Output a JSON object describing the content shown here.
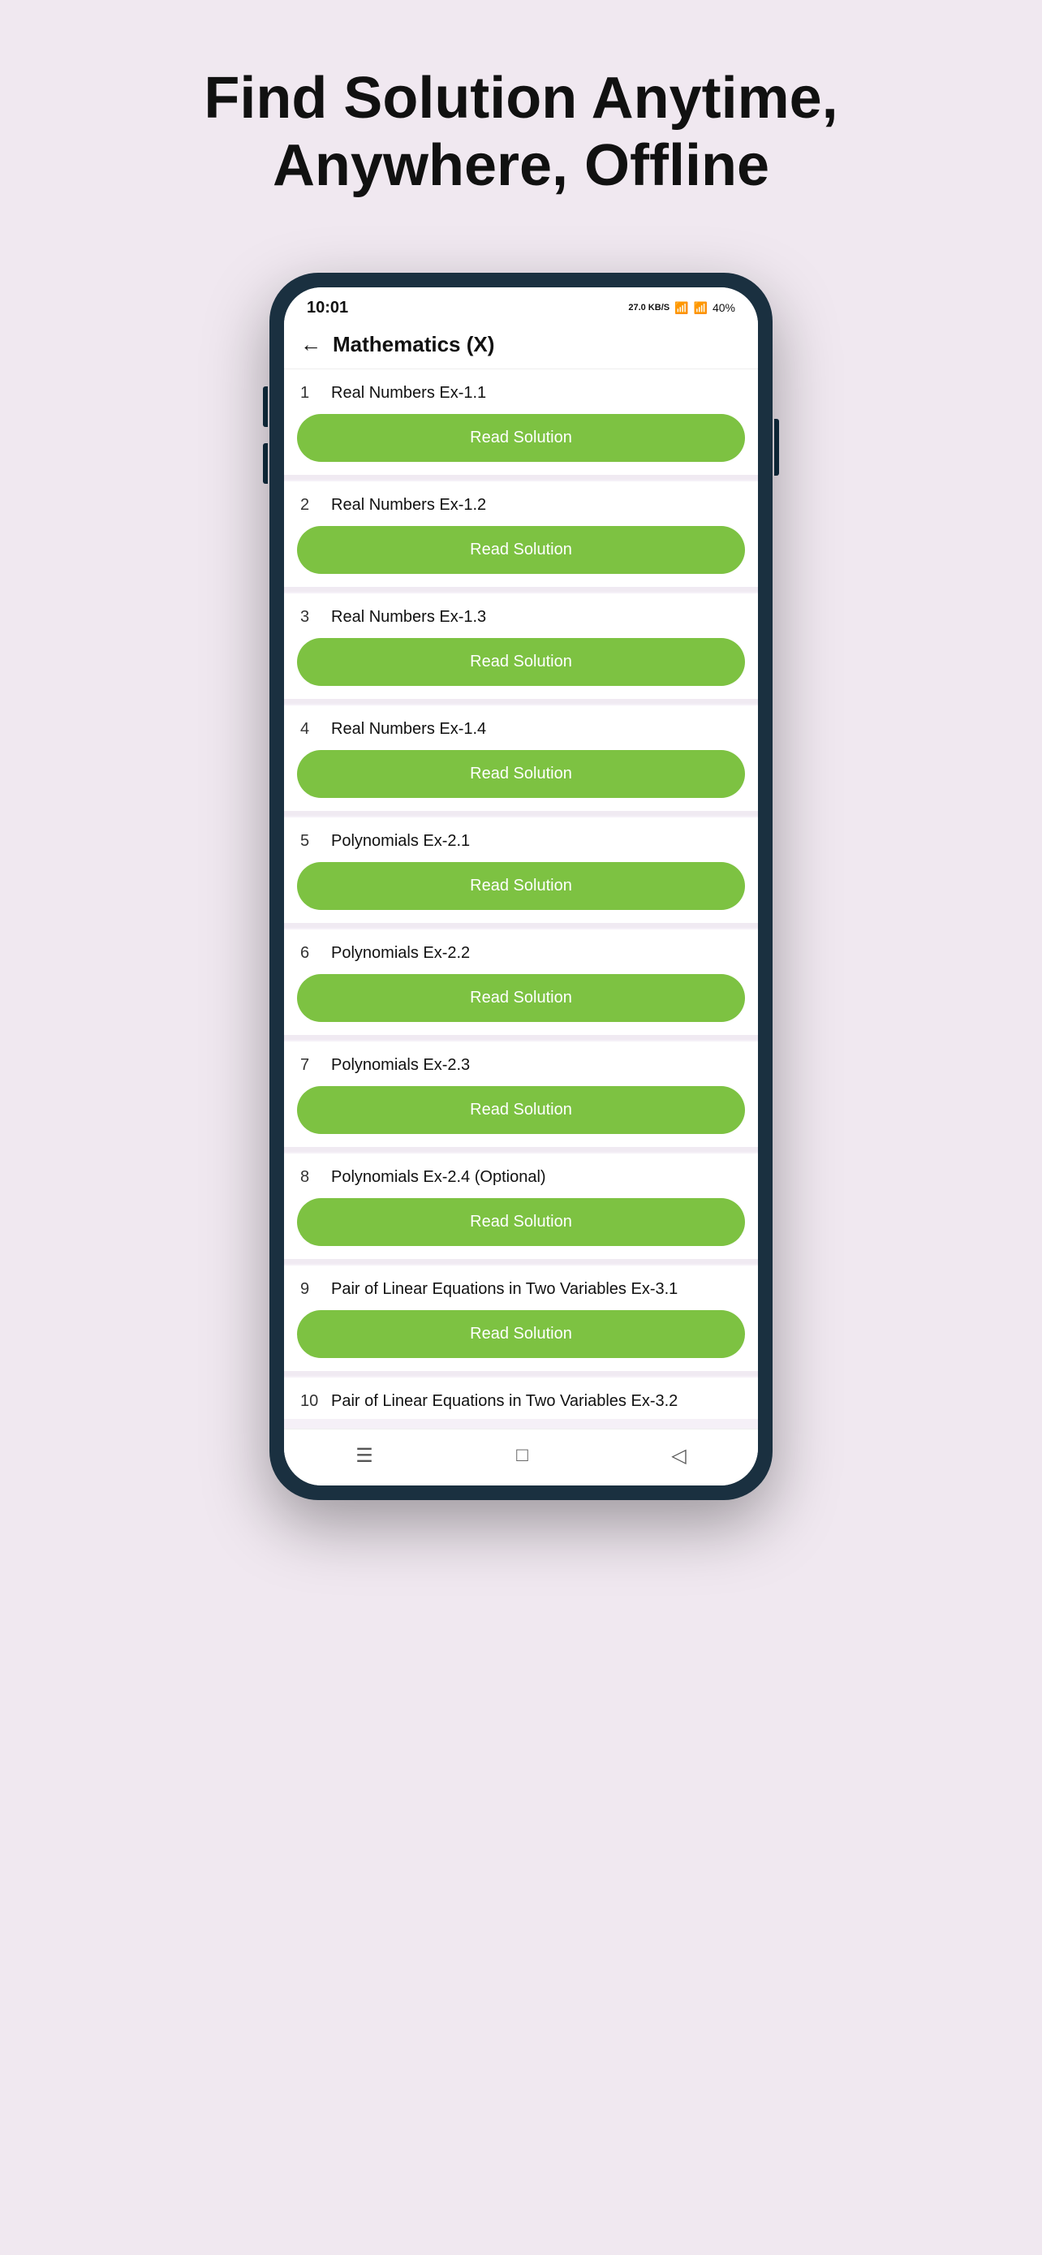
{
  "headline": "Find Solution Anytime, Anywhere, Offline",
  "status": {
    "time": "10:01",
    "kb": "27.0\nKB/S",
    "battery": "40%"
  },
  "nav": {
    "title": "Mathematics (X)",
    "back_label": "←"
  },
  "read_button_label": "Read Solution",
  "items": [
    {
      "number": "1",
      "title": "Real Numbers Ex-1.1"
    },
    {
      "number": "2",
      "title": "Real Numbers Ex-1.2"
    },
    {
      "number": "3",
      "title": "Real Numbers Ex-1.3"
    },
    {
      "number": "4",
      "title": "Real Numbers Ex-1.4"
    },
    {
      "number": "5",
      "title": "Polynomials Ex-2.1"
    },
    {
      "number": "6",
      "title": "Polynomials Ex-2.2"
    },
    {
      "number": "7",
      "title": "Polynomials Ex-2.3"
    },
    {
      "number": "8",
      "title": "Polynomials Ex-2.4 (Optional)"
    },
    {
      "number": "9",
      "title": "Pair of Linear Equations in Two Variables Ex-3.1"
    },
    {
      "number": "10",
      "title": "Pair of Linear Equations in Two Variables Ex-3.2"
    }
  ],
  "bottom_nav": {
    "menu_icon": "☰",
    "square_icon": "□",
    "back_icon": "◁"
  },
  "colors": {
    "background": "#f0e8f0",
    "green_button": "#7dc242",
    "phone_body": "#1a3040"
  }
}
